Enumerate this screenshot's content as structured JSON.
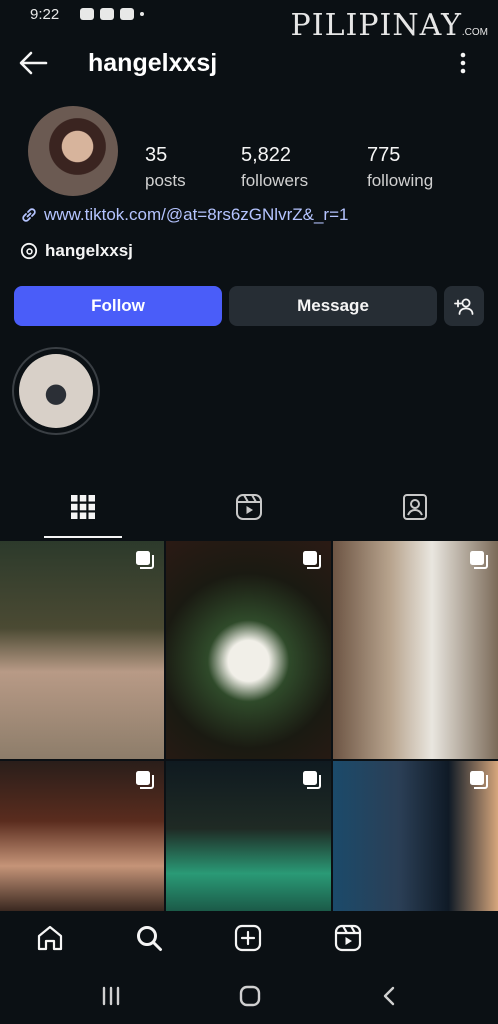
{
  "status_bar": {
    "time": "9:22"
  },
  "watermark": {
    "brand": "PILIPINAY",
    "suffix": ".COM"
  },
  "header": {
    "username": "hangelxxsj"
  },
  "profile": {
    "posts_count": "35",
    "posts_label": "posts",
    "followers_count": "5,822",
    "followers_label": "followers",
    "following_count": "775",
    "following_label": "following",
    "link": "www.tiktok.com/@at=8rs6zGNlvrZ&_r=1",
    "threads_handle": "hangelxxsj"
  },
  "actions": {
    "follow": "Follow",
    "message": "Message"
  },
  "colors": {
    "accent": "#4a5df9",
    "link": "#b5c4ff",
    "background": "#0b1014",
    "button_dark": "#262d34"
  },
  "tabs": [
    "grid-icon",
    "reels-icon",
    "tagged-icon"
  ],
  "bottom_nav": [
    "home-icon",
    "search-icon",
    "create-icon",
    "reels-icon"
  ]
}
